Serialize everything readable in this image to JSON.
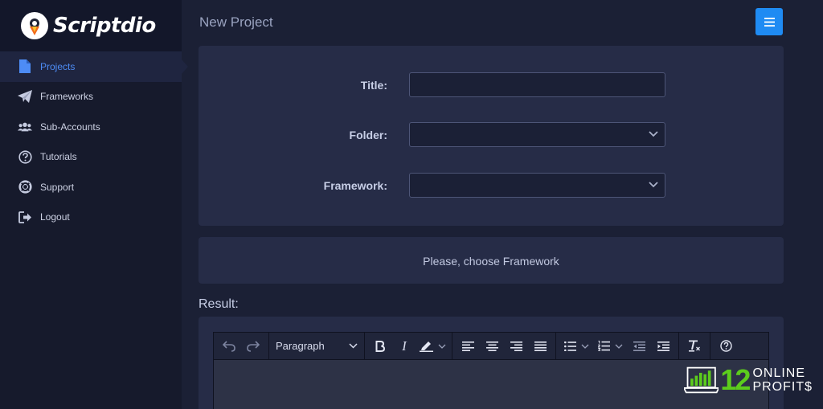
{
  "app": {
    "name": "Scriptdio"
  },
  "sidebar": {
    "items": [
      {
        "label": "Projects",
        "icon": "file-icon",
        "active": true
      },
      {
        "label": "Frameworks",
        "icon": "paper-plane-icon"
      },
      {
        "label": "Sub-Accounts",
        "icon": "users-icon"
      },
      {
        "label": "Tutorials",
        "icon": "question-circle-icon"
      },
      {
        "label": "Support",
        "icon": "life-ring-icon"
      },
      {
        "label": "Logout",
        "icon": "logout-icon"
      }
    ]
  },
  "header": {
    "title": "New Project",
    "menu_icon": "hamburger-icon"
  },
  "form": {
    "title_label": "Title:",
    "title_value": "",
    "folder_label": "Folder:",
    "folder_value": "",
    "framework_label": "Framework:",
    "framework_value": ""
  },
  "info": {
    "message": "Please, choose Framework"
  },
  "result": {
    "label": "Result:",
    "editor": {
      "block_format": "Paragraph",
      "italic_glyph": "I"
    }
  },
  "watermark": {
    "number": "12",
    "line1": "ONLINE",
    "line2": "PROFIT$"
  },
  "colors": {
    "accent": "#1f8bf3",
    "active_nav": "#4d8cf5",
    "watermark_green": "#5ccd1c"
  }
}
